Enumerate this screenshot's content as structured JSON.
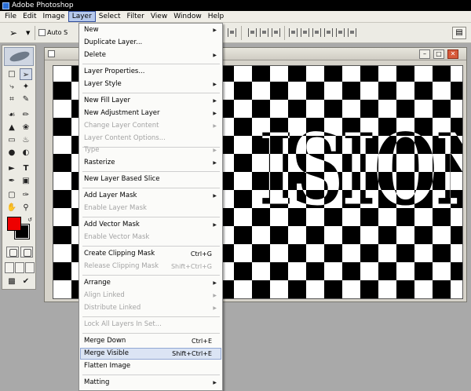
{
  "window": {
    "title": "Adobe Photoshop"
  },
  "menubar": {
    "items": [
      "File",
      "Edit",
      "Image",
      "Layer",
      "Select",
      "Filter",
      "View",
      "Window",
      "Help"
    ]
  },
  "options": {
    "auto_select_label": "Auto S"
  },
  "document": {
    "canvas_text": "ISION"
  },
  "layer_menu": {
    "items": [
      {
        "label": "New",
        "submenu": true,
        "disabled": false
      },
      {
        "label": "Duplicate Layer...",
        "disabled": false
      },
      {
        "label": "Delete",
        "submenu": true,
        "disabled": false
      },
      {
        "label": "Layer Properties...",
        "disabled": false
      },
      {
        "label": "Layer Style",
        "submenu": true,
        "disabled": false
      },
      {
        "label": "New Fill Layer",
        "submenu": true,
        "disabled": false
      },
      {
        "label": "New Adjustment Layer",
        "submenu": true,
        "disabled": false
      },
      {
        "label": "Change Layer Content",
        "submenu": true,
        "disabled": true
      },
      {
        "label": "Layer Content Options...",
        "disabled": true
      },
      {
        "label": "Type",
        "submenu": true,
        "disabled": true
      },
      {
        "label": "Rasterize",
        "submenu": true,
        "disabled": false
      },
      {
        "label": "New Layer Based Slice",
        "disabled": false
      },
      {
        "label": "Add Layer Mask",
        "submenu": true,
        "disabled": false
      },
      {
        "label": "Enable Layer Mask",
        "disabled": true
      },
      {
        "label": "Add Vector Mask",
        "submenu": true,
        "disabled": false
      },
      {
        "label": "Enable Vector Mask",
        "disabled": true
      },
      {
        "label": "Create Clipping Mask",
        "shortcut": "Ctrl+G",
        "disabled": false
      },
      {
        "label": "Release Clipping Mask",
        "shortcut": "Shift+Ctrl+G",
        "disabled": true
      },
      {
        "label": "Arrange",
        "submenu": true,
        "disabled": false
      },
      {
        "label": "Align Linked",
        "submenu": true,
        "disabled": true
      },
      {
        "label": "Distribute Linked",
        "submenu": true,
        "disabled": true
      },
      {
        "label": "Lock All Layers In Set...",
        "disabled": true
      },
      {
        "label": "Merge Down",
        "shortcut": "Ctrl+E",
        "disabled": false
      },
      {
        "label": "Merge Visible",
        "shortcut": "Shift+Ctrl+E",
        "disabled": false,
        "highlighted": true
      },
      {
        "label": "Flatten Image",
        "disabled": false
      },
      {
        "label": "Matting",
        "submenu": true,
        "disabled": false
      }
    ]
  },
  "colors": {
    "foreground": "#ee0000",
    "background": "#000000",
    "highlight": "#dbe4f4"
  }
}
